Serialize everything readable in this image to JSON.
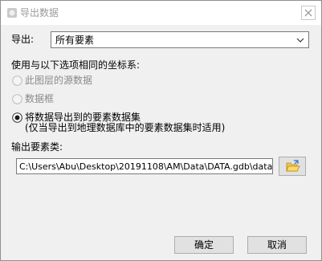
{
  "window": {
    "title": "导出数据",
    "close_icon": "close-icon"
  },
  "export": {
    "label": "导出:",
    "selected_value": "所有要素"
  },
  "coord": {
    "label": "使用与以下选项相同的坐标系:",
    "options": [
      {
        "label": "此图层的源数据",
        "enabled": false,
        "checked": false
      },
      {
        "label": "数据框",
        "enabled": false,
        "checked": false
      },
      {
        "label": "将数据导出到的要素数据集",
        "enabled": true,
        "checked": true
      }
    ],
    "note": "(仅当导出到地理数据库中的要素数据集时适用)"
  },
  "output": {
    "label": "输出要素类:",
    "path": "C:\\Users\\Abu\\Desktop\\20191108\\AM\\Data\\DATA.gdb\\data\\tre",
    "browse_icon": "folder-open-icon"
  },
  "buttons": {
    "ok": "确定",
    "cancel": "取消"
  }
}
